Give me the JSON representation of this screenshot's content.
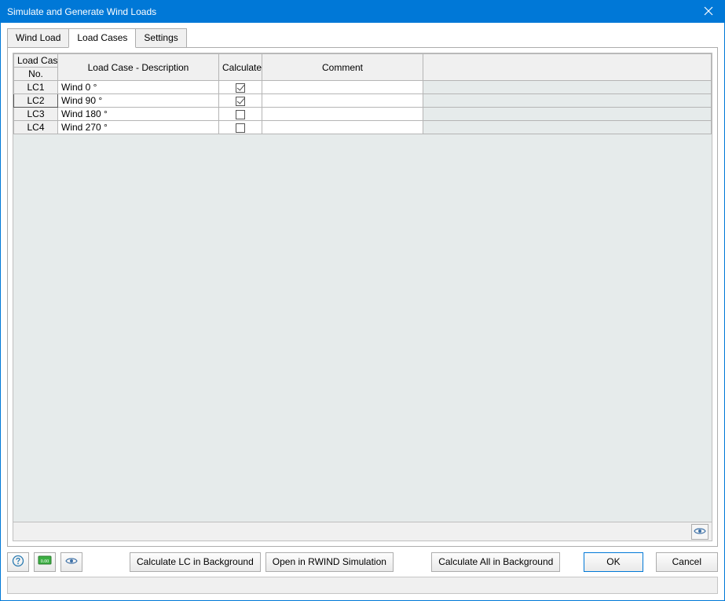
{
  "window": {
    "title": "Simulate and Generate Wind Loads"
  },
  "tabs": [
    {
      "label": "Wind Load",
      "active": false
    },
    {
      "label": "Load Cases",
      "active": true
    },
    {
      "label": "Settings",
      "active": false
    }
  ],
  "grid": {
    "headers": {
      "no_line1": "Load Case",
      "no_line2": "No.",
      "desc": "Load Case - Description",
      "calc": "Calculated",
      "comment": "Comment"
    },
    "rows": [
      {
        "no": "LC1",
        "desc": "Wind 0 °",
        "calculated": true,
        "comment": "",
        "selected": false
      },
      {
        "no": "LC2",
        "desc": "Wind 90 °",
        "calculated": true,
        "comment": "",
        "selected": true
      },
      {
        "no": "LC3",
        "desc": "Wind 180 °",
        "calculated": false,
        "comment": "",
        "selected": false
      },
      {
        "no": "LC4",
        "desc": "Wind 270 °",
        "calculated": false,
        "comment": "",
        "selected": false
      }
    ]
  },
  "buttons": {
    "calc_lc_bg": "Calculate LC in Background",
    "open_rwind": "Open in RWIND Simulation",
    "calc_all_bg": "Calculate All in Background",
    "ok": "OK",
    "cancel": "Cancel"
  }
}
